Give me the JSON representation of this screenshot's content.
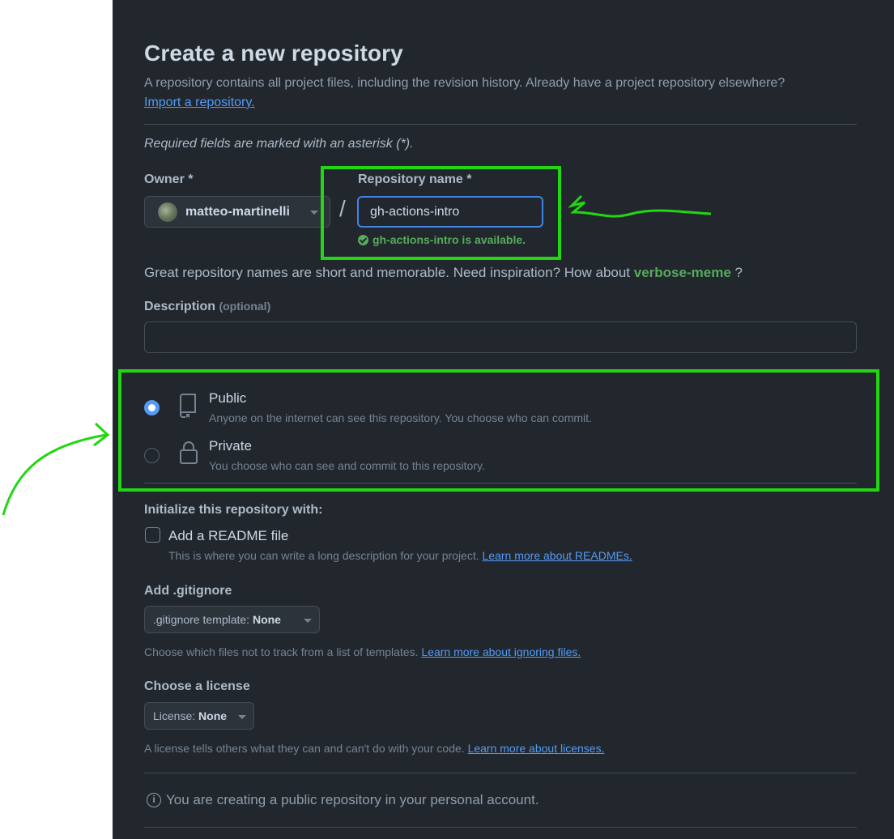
{
  "page": {
    "title": "Create a new repository",
    "subtitle": "A repository contains all project files, including the revision history. Already have a project repository elsewhere?",
    "import_link": "Import a repository.",
    "required_note": "Required fields are marked with an asterisk (*)."
  },
  "owner": {
    "label": "Owner *",
    "name": "matteo-martinelli"
  },
  "repo_name": {
    "separator": "/",
    "label": "Repository name *",
    "value": "gh-actions-intro",
    "availability": "gh-actions-intro is available."
  },
  "inspiration": {
    "text": "Great repository names are short and memorable. Need inspiration? How about",
    "suggestion": "verbose-meme",
    "tail": "?"
  },
  "description": {
    "label": "Description",
    "optional": "(optional)",
    "value": ""
  },
  "visibility": {
    "selected": "Public",
    "options": [
      {
        "label": "Public",
        "description": "Anyone on the internet can see this repository. You choose who can commit.",
        "icon": "repo-icon"
      },
      {
        "label": "Private",
        "description": "You choose who can see and commit to this repository.",
        "icon": "lock-icon"
      }
    ]
  },
  "initialize": {
    "heading": "Initialize this repository with:",
    "readme_label": "Add a README file",
    "readme_checked": false,
    "readme_hint": "This is where you can write a long description for your project.",
    "readme_link": "Learn more about READMEs."
  },
  "gitignore": {
    "heading": "Add .gitignore",
    "select_prefix": ".gitignore template:",
    "select_value": "None",
    "hint": "Choose which files not to track from a list of templates.",
    "link": "Learn more about ignoring files."
  },
  "license": {
    "heading": "Choose a license",
    "select_prefix": "License:",
    "select_value": "None",
    "hint": "A license tells others what they can and can't do with your code.",
    "link": "Learn more about licenses."
  },
  "footer": {
    "info_icon": "info-icon",
    "info_text": "You are creating a public repository in your personal account."
  },
  "colors": {
    "background": "#22272e",
    "accent_link": "#539bf5",
    "success": "#57ab5a",
    "annotation": "#22d612"
  }
}
